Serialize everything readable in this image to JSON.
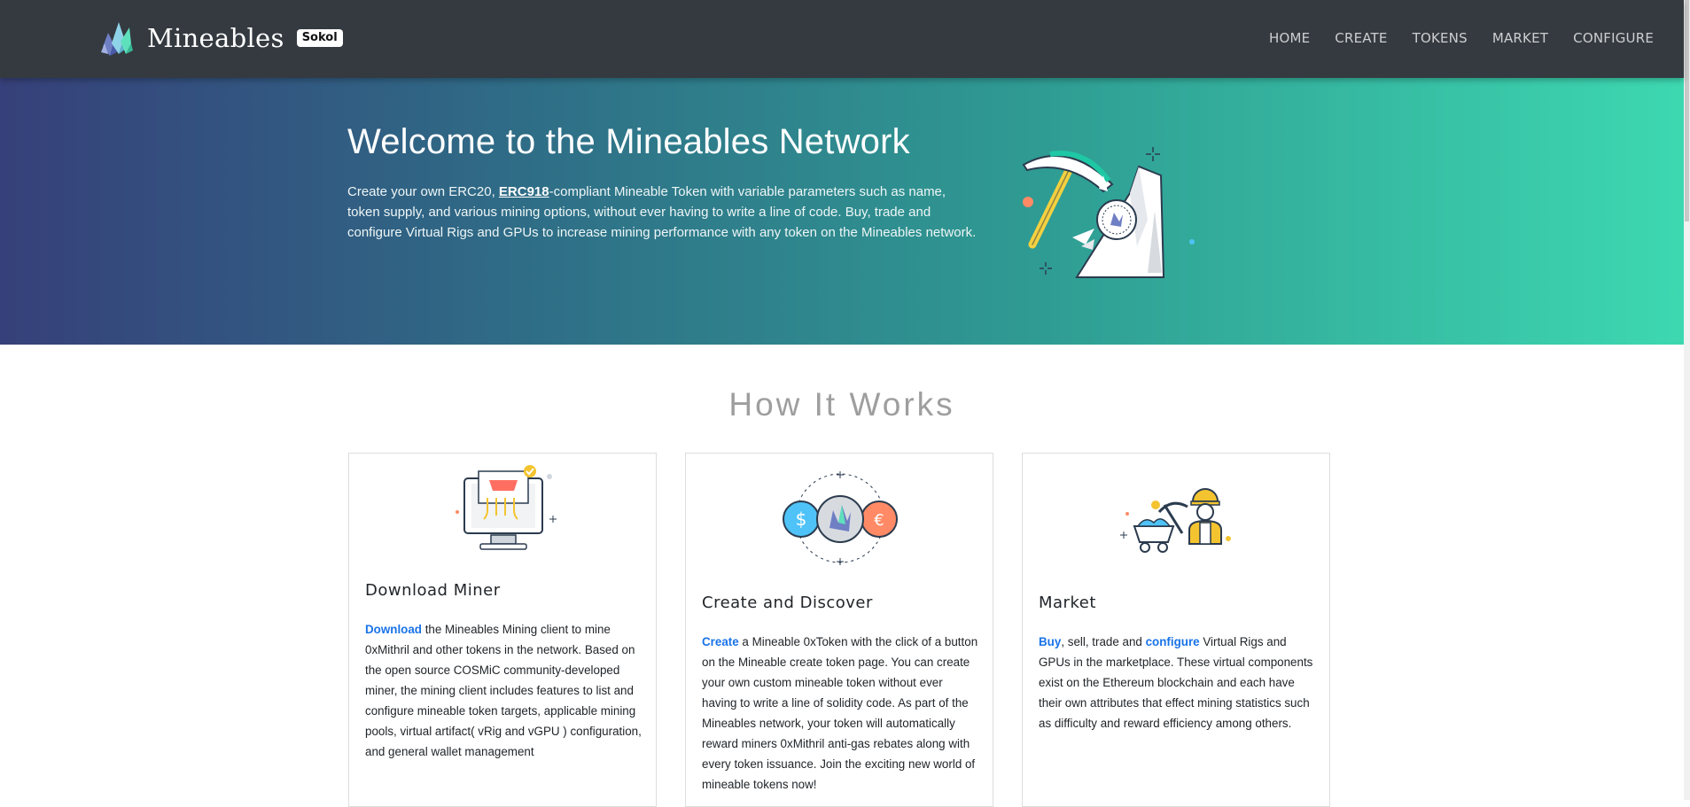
{
  "brand": {
    "name": "Mineables",
    "network_badge": "Sokol",
    "logo_icon": "crystal-logo-icon"
  },
  "nav": {
    "items": [
      "HOME",
      "CREATE",
      "TOKENS",
      "MARKET",
      "CONFIGURE"
    ]
  },
  "hero": {
    "title": "Welcome to the Mineables Network",
    "text_before_link": "Create your own ERC20, ",
    "link_text": "ERC918",
    "text_after_link": "-compliant Mineable Token with variable parameters such as name, token supply, and various mining options, without ever having to write a line of code. Buy, trade and configure Virtual Rigs and GPUs to increase mining performance with any token on the Mineables network.",
    "illustration_icon": "pickaxe-mountain-icon"
  },
  "how_it_works": {
    "title": "How It Works",
    "cards": [
      {
        "icon": "monitor-mining-icon",
        "title": "Download Miner",
        "link1": "Download",
        "text1": " the Mineables Mining client to mine 0xMithril and other tokens in the network. Based on the open source COSMiC community-developed miner, the mining client includes features to list and configure mineable token targets, applicable mining pools, virtual artifact( vRig and vGPU ) configuration, and general wallet management"
      },
      {
        "icon": "currency-exchange-icon",
        "title": "Create and Discover",
        "link1": "Create",
        "text1": " a Mineable 0xToken with the click of a button on the Mineable create token page. You can create your own custom mineable token without ever having to write a line of solidity code. As part of the Mineables network, your token will automatically reward miners 0xMithril anti-gas rebates along with every token issuance. Join the exciting new world of mineable tokens now!"
      },
      {
        "icon": "miner-cart-icon",
        "title": "Market",
        "link1": "Buy",
        "text1": ", sell, trade and ",
        "link2": "configure",
        "text2": " Virtual Rigs and GPUs in the marketplace. These virtual components exist on the Ethereum blockchain and each have their own attributes that effect mining statistics such as difficulty and reward efficiency among others."
      }
    ]
  },
  "colors": {
    "navbar": "#343a40",
    "hero_gradient_start": "#36407a",
    "hero_gradient_end": "#3dd8b1",
    "link": "#1a73e8",
    "section_title": "#9e9e9e"
  }
}
